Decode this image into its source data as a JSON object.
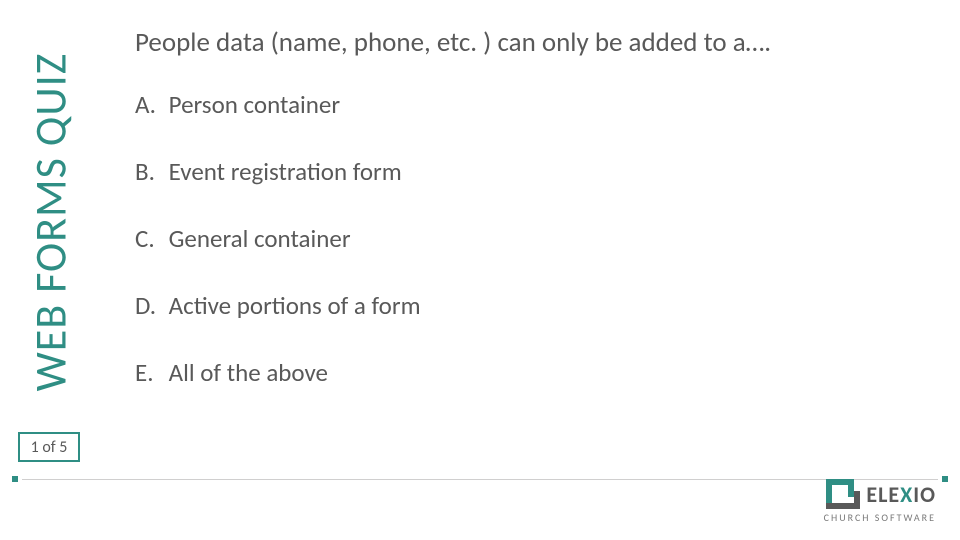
{
  "sidebar": {
    "title": "WEB FORMS QUIZ"
  },
  "pager": {
    "text": "1 of 5"
  },
  "question": "People data (name, phone, etc. ) can only be added to a….",
  "options": [
    {
      "letter": "A.",
      "text": "Person container"
    },
    {
      "letter": "B.",
      "text": "Event registration form"
    },
    {
      "letter": "C.",
      "text": "General container"
    },
    {
      "letter": "D.",
      "text": "Active portions of a form"
    },
    {
      "letter": "E.",
      "text": "All of the above"
    }
  ],
  "brand": {
    "name_part1": "ELE",
    "name_part2": "X",
    "name_part3": "IO",
    "tagline": "CHURCH SOFTWARE"
  },
  "colors": {
    "accent": "#2f8e84",
    "text": "#595959"
  }
}
